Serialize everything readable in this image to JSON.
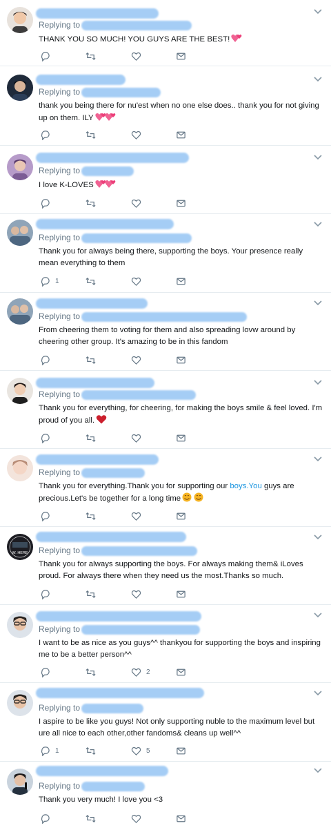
{
  "tweets": [
    {
      "replying_label": "Replying to",
      "text": "THANK YOU SO MUCH! YOU GUYS ARE THE BEST!",
      "emoji": "pink-hearts",
      "reply_count": "",
      "like_count": "",
      "avatar": "person-boy-avatar"
    },
    {
      "replying_label": "Replying to",
      "text": "thank you being there for nu'est when no one else does.. thank you for not giving up on them. ILY",
      "emoji": "pink-hearts-double",
      "reply_count": "",
      "like_count": "",
      "avatar": "person-dark-avatar"
    },
    {
      "replying_label": "Replying to",
      "text": "I love K-LOVES",
      "emoji": "pink-hearts-double",
      "reply_count": "",
      "like_count": "",
      "avatar": "person-purple-avatar"
    },
    {
      "replying_label": "Replying to",
      "text": "Thank you for always being there, supporting the boys. Your presence really mean everything to them",
      "emoji": "",
      "reply_count": "1",
      "like_count": "",
      "avatar": "group-blue-avatar"
    },
    {
      "replying_label": "Replying to",
      "text": "From cheering them to voting for them and also spreading lovw around by cheering other group. It's amazing to be in this fandom",
      "emoji": "",
      "reply_count": "",
      "like_count": "",
      "avatar": "group-blue-avatar"
    },
    {
      "replying_label": "Replying to",
      "text": "Thank you for everything, for cheering, for making the boys smile & feel loved. I'm proud of you all.",
      "emoji": "red-heart",
      "reply_count": "",
      "like_count": "",
      "avatar": "person-smile-avatar"
    },
    {
      "replying_label": "Replying to",
      "text_before": "Thank you for everything.Thank you for supporting our ",
      "link": "boys.You",
      "text_after": " guys are precious.Let's be together for a long time",
      "emoji": "smiles",
      "reply_count": "",
      "like_count": "",
      "avatar": "person-pale-avatar"
    },
    {
      "replying_label": "Replying to",
      "text": "Thank you for always supporting the boys. For always making them& iLoves proud. For always there when they need us the most.Thanks so much.",
      "emoji": "",
      "reply_count": "",
      "like_count": "",
      "avatar": "wnere-logo-avatar",
      "avatar_text": "W. HERE"
    },
    {
      "replying_label": "Replying to",
      "text": "I want to be as nice as you guys^^ thankyou for supporting the boys and inspiring me to be a better person^^",
      "emoji": "",
      "reply_count": "",
      "like_count": "2",
      "avatar": "person-glasses-avatar"
    },
    {
      "replying_label": "Replying to",
      "text": "I aspire to be like you guys! Not only supporting nuble to the maximum level but ure all nice to each other,other fandoms& cleans up well^^",
      "emoji": "",
      "reply_count": "1",
      "like_count": "5",
      "avatar": "person-glasses-avatar"
    },
    {
      "replying_label": "Replying to",
      "text": "Thank you very much! I love you <3",
      "emoji": "",
      "reply_count": "",
      "like_count": "",
      "avatar": "person-mic-avatar"
    }
  ],
  "colors": {
    "accent": "#1b95e0",
    "muted": "#657786",
    "blur": "#9cc8f4",
    "divider": "#e6ecf0"
  },
  "icons": [
    "reply-icon",
    "retweet-icon",
    "like-icon",
    "dm-icon",
    "chevron-down-icon"
  ]
}
